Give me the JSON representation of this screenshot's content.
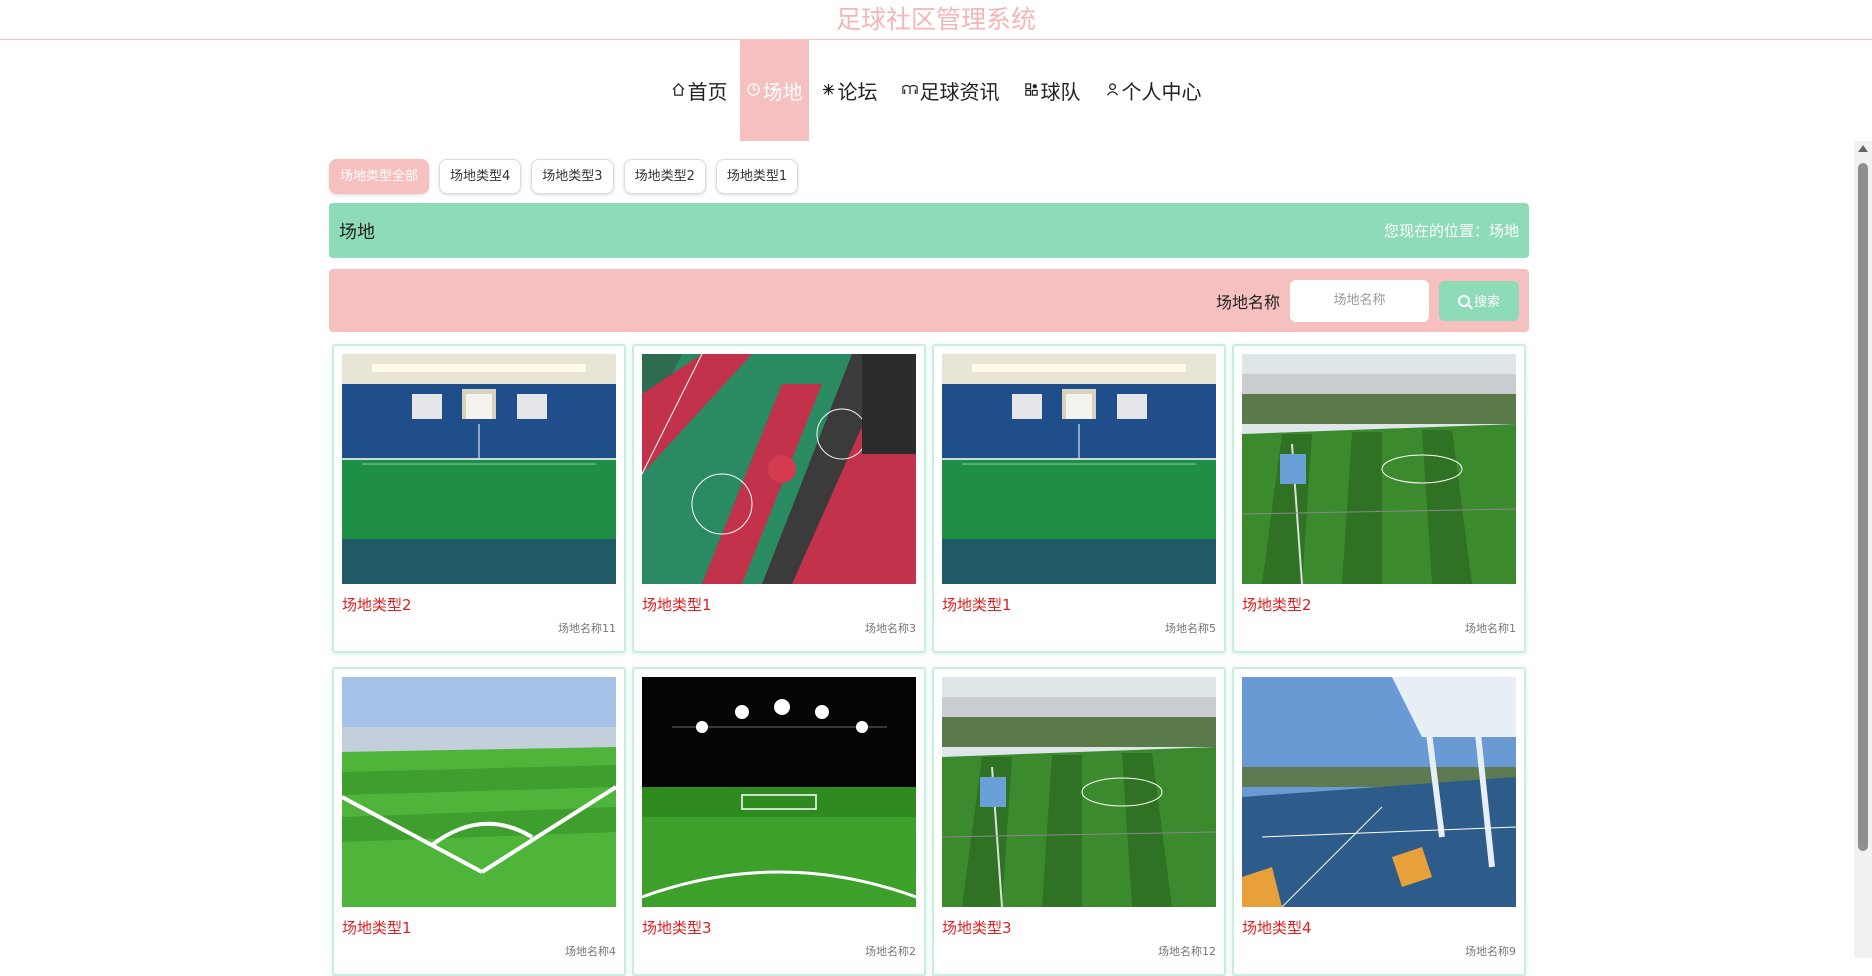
{
  "app": {
    "title": "足球社区管理系统"
  },
  "nav": {
    "items": [
      {
        "label": "首页",
        "icon": "home-icon",
        "active": false
      },
      {
        "label": "场地",
        "icon": "clock-icon",
        "active": true
      },
      {
        "label": "论坛",
        "icon": "snowflake-icon",
        "active": false
      },
      {
        "label": "足球资讯",
        "icon": "book-icon",
        "active": false
      },
      {
        "label": "球队",
        "icon": "grid-icon",
        "active": false
      },
      {
        "label": "个人中心",
        "icon": "user-icon",
        "active": false
      }
    ]
  },
  "filters": {
    "items": [
      {
        "label": "场地类型全部",
        "active": true
      },
      {
        "label": "场地类型4",
        "active": false
      },
      {
        "label": "场地类型3",
        "active": false
      },
      {
        "label": "场地类型2",
        "active": false
      },
      {
        "label": "场地类型1",
        "active": false
      }
    ]
  },
  "breadcrumb": {
    "title": "场地",
    "location": "您现在的位置：场地"
  },
  "search": {
    "label": "场地名称",
    "placeholder": "场地名称",
    "value": "",
    "button_label": "搜索"
  },
  "venues": [
    {
      "type": "场地类型2",
      "name": "场地名称11",
      "scene": "indoor"
    },
    {
      "type": "场地类型1",
      "name": "场地名称3",
      "scene": "basketball"
    },
    {
      "type": "场地类型1",
      "name": "场地名称5",
      "scene": "indoor"
    },
    {
      "type": "场地类型2",
      "name": "场地名称1",
      "scene": "fenced"
    },
    {
      "type": "场地类型1",
      "name": "场地名称4",
      "scene": "corner"
    },
    {
      "type": "场地类型3",
      "name": "场地名称2",
      "scene": "night"
    },
    {
      "type": "场地类型3",
      "name": "场地名称12",
      "scene": "fenced"
    },
    {
      "type": "场地类型4",
      "name": "场地名称9",
      "scene": "park"
    }
  ],
  "colors": {
    "brand_pink": "#f6c0c0",
    "brand_green": "#8ddbb7",
    "type_red": "#e02020"
  }
}
